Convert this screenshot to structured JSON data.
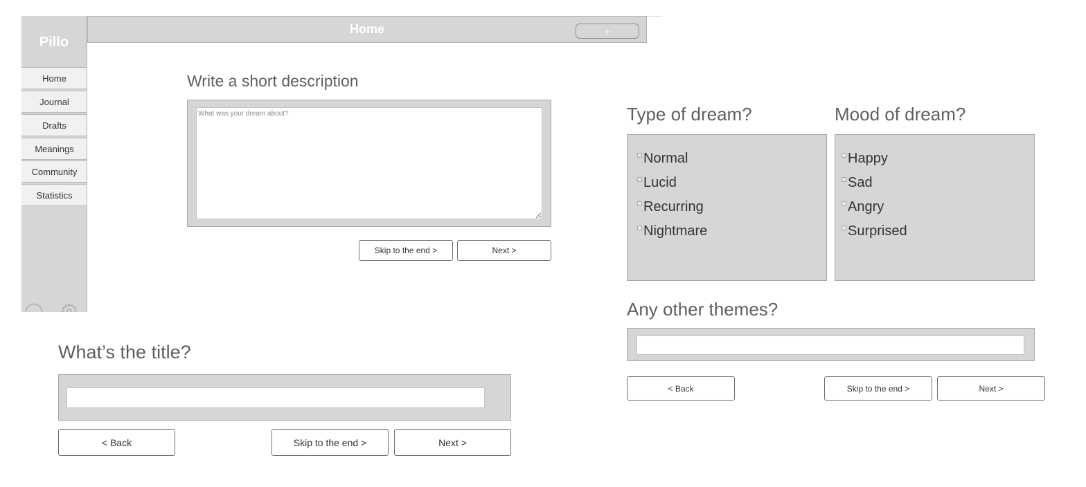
{
  "app": {
    "logo": "Pillo"
  },
  "sidebar": {
    "items": [
      {
        "label": "Home"
      },
      {
        "label": "Journal"
      },
      {
        "label": "Drafts"
      },
      {
        "label": "Meanings"
      },
      {
        "label": "Community"
      },
      {
        "label": "Statistics"
      }
    ],
    "icons": [
      "avatar-icon",
      "gear-icon"
    ]
  },
  "header": {
    "title": "Home",
    "add_label": "+"
  },
  "description_step": {
    "heading": "Write a short description",
    "placeholder": "What was your dream about?",
    "value": "",
    "skip_label": "Skip to the end >",
    "next_label": "Next >"
  },
  "details_step": {
    "type": {
      "heading": "Type of dream?",
      "options": [
        {
          "label": "Normal",
          "checked": false
        },
        {
          "label": "Lucid",
          "checked": false
        },
        {
          "label": "Recurring",
          "checked": false
        },
        {
          "label": "Nightmare",
          "checked": false
        }
      ]
    },
    "mood": {
      "heading": "Mood of dream?",
      "options": [
        {
          "label": "Happy",
          "checked": false
        },
        {
          "label": "Sad",
          "checked": false
        },
        {
          "label": "Angry",
          "checked": false
        },
        {
          "label": "Surprised",
          "checked": false
        }
      ]
    },
    "themes": {
      "heading": "Any other themes?",
      "value": ""
    },
    "back_label": "< Back",
    "skip_label": "Skip to the end >",
    "next_label": "Next >"
  },
  "title_step": {
    "heading": "What’s the title?",
    "value": "",
    "back_label": "< Back",
    "skip_label": "Skip to the end >",
    "next_label": "Next >"
  },
  "colors": {
    "panel": "#d6d6d6",
    "panel_border": "#a8a8a8",
    "nav_item": "#f1f1f1",
    "heading": "#5f5f5f"
  }
}
